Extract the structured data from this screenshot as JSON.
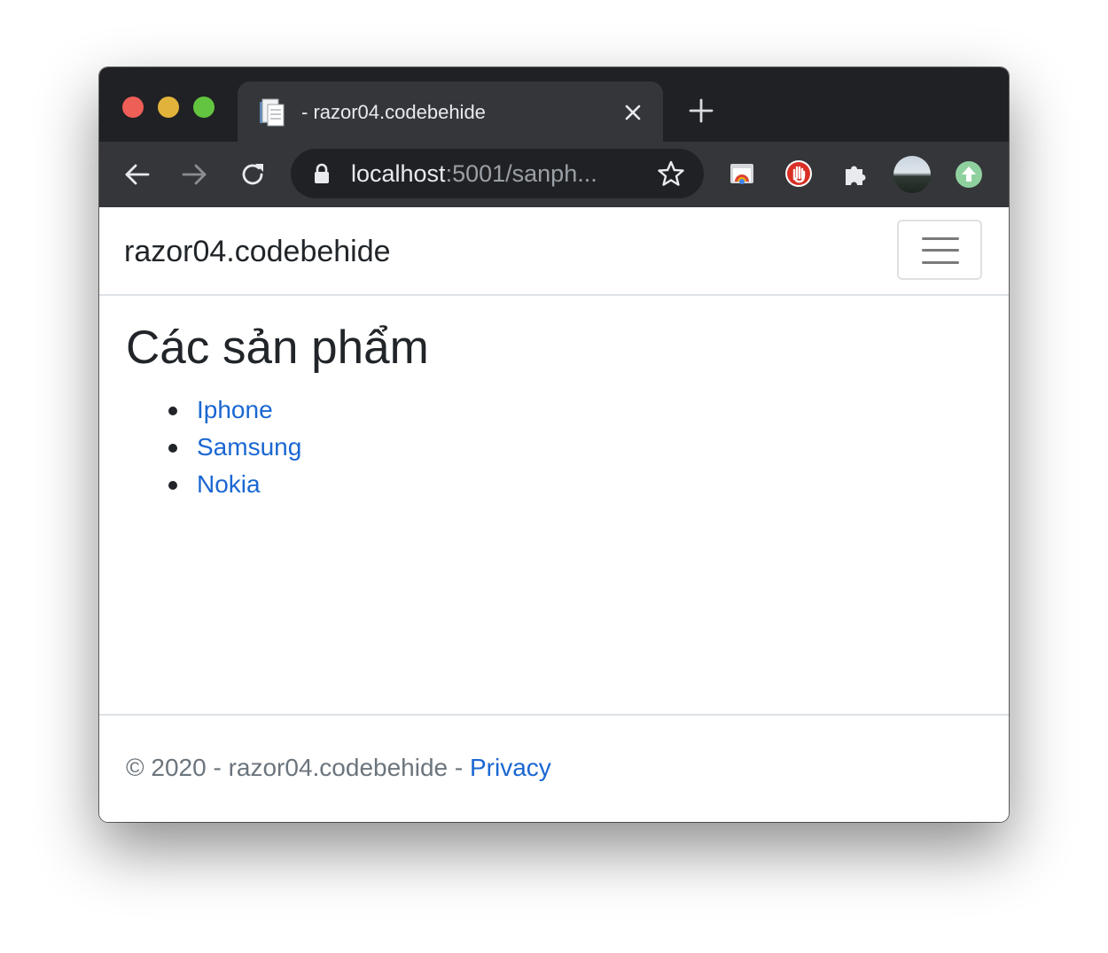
{
  "browser": {
    "tab": {
      "title": "- razor04.codebehide",
      "close_icon": "close-icon",
      "favicon": "document-icon"
    },
    "new_tab_icon": "plus-icon",
    "toolbar": {
      "back_icon": "arrow-left-icon",
      "forward_icon": "arrow-right-icon",
      "reload_icon": "reload-icon",
      "url_host": "localhost",
      "url_rest": ":5001/sanph...",
      "bookmark_icon": "star-icon",
      "extensions": [
        "cast-icon",
        "adblock-hand-icon",
        "puzzle-icon",
        "profile-avatar",
        "update-arrow-icon"
      ]
    }
  },
  "navbar": {
    "brand": "razor04.codebehide",
    "toggler_icon": "hamburger-menu-icon"
  },
  "main": {
    "heading": "Các sản phẩm",
    "products": [
      "Iphone",
      "Samsung",
      "Nokia"
    ]
  },
  "footer": {
    "text": "© 2020 - razor04.codebehide - ",
    "privacy_link": "Privacy"
  },
  "colors": {
    "link": "#1a67d2",
    "tab_bar": "#202124",
    "toolbar": "#35363a"
  }
}
